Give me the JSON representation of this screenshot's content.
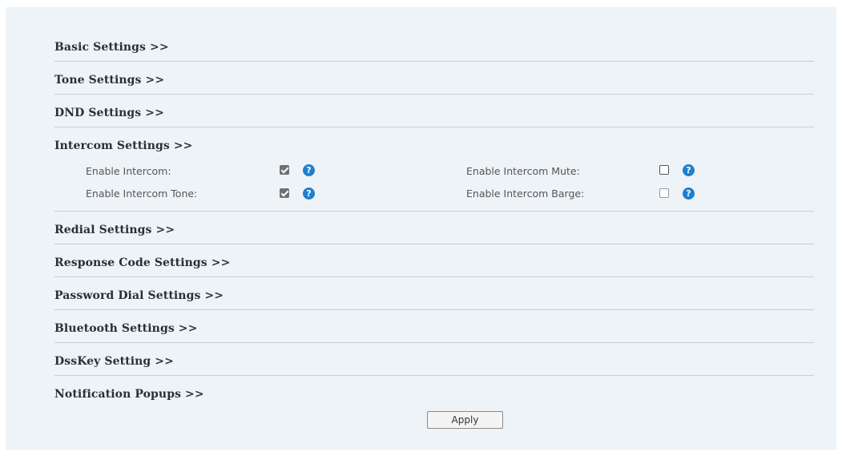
{
  "sections": [
    {
      "label": "Basic Settings >>"
    },
    {
      "label": "Tone Settings >>"
    },
    {
      "label": "DND Settings >>"
    },
    {
      "label": "Intercom Settings >>"
    },
    {
      "label": "Redial Settings >>"
    },
    {
      "label": "Response Code Settings >>"
    },
    {
      "label": "Password Dial Settings >>"
    },
    {
      "label": "Bluetooth Settings >>"
    },
    {
      "label": "DssKey Setting >>"
    },
    {
      "label": "Notification Popups >>"
    }
  ],
  "intercom": {
    "enable_intercom": {
      "label": "Enable Intercom:",
      "checked": true
    },
    "enable_intercom_tone": {
      "label": "Enable Intercom Tone:",
      "checked": true
    },
    "enable_intercom_mute": {
      "label": "Enable Intercom Mute:",
      "checked": false
    },
    "enable_intercom_barge": {
      "label": "Enable Intercom Barge:",
      "checked": false
    }
  },
  "help_glyph": "?",
  "apply_label": "Apply",
  "colors": {
    "panel_bg": "#eef3f7",
    "help_icon": "#1f7fcf",
    "divider": "#c9cdd1"
  }
}
